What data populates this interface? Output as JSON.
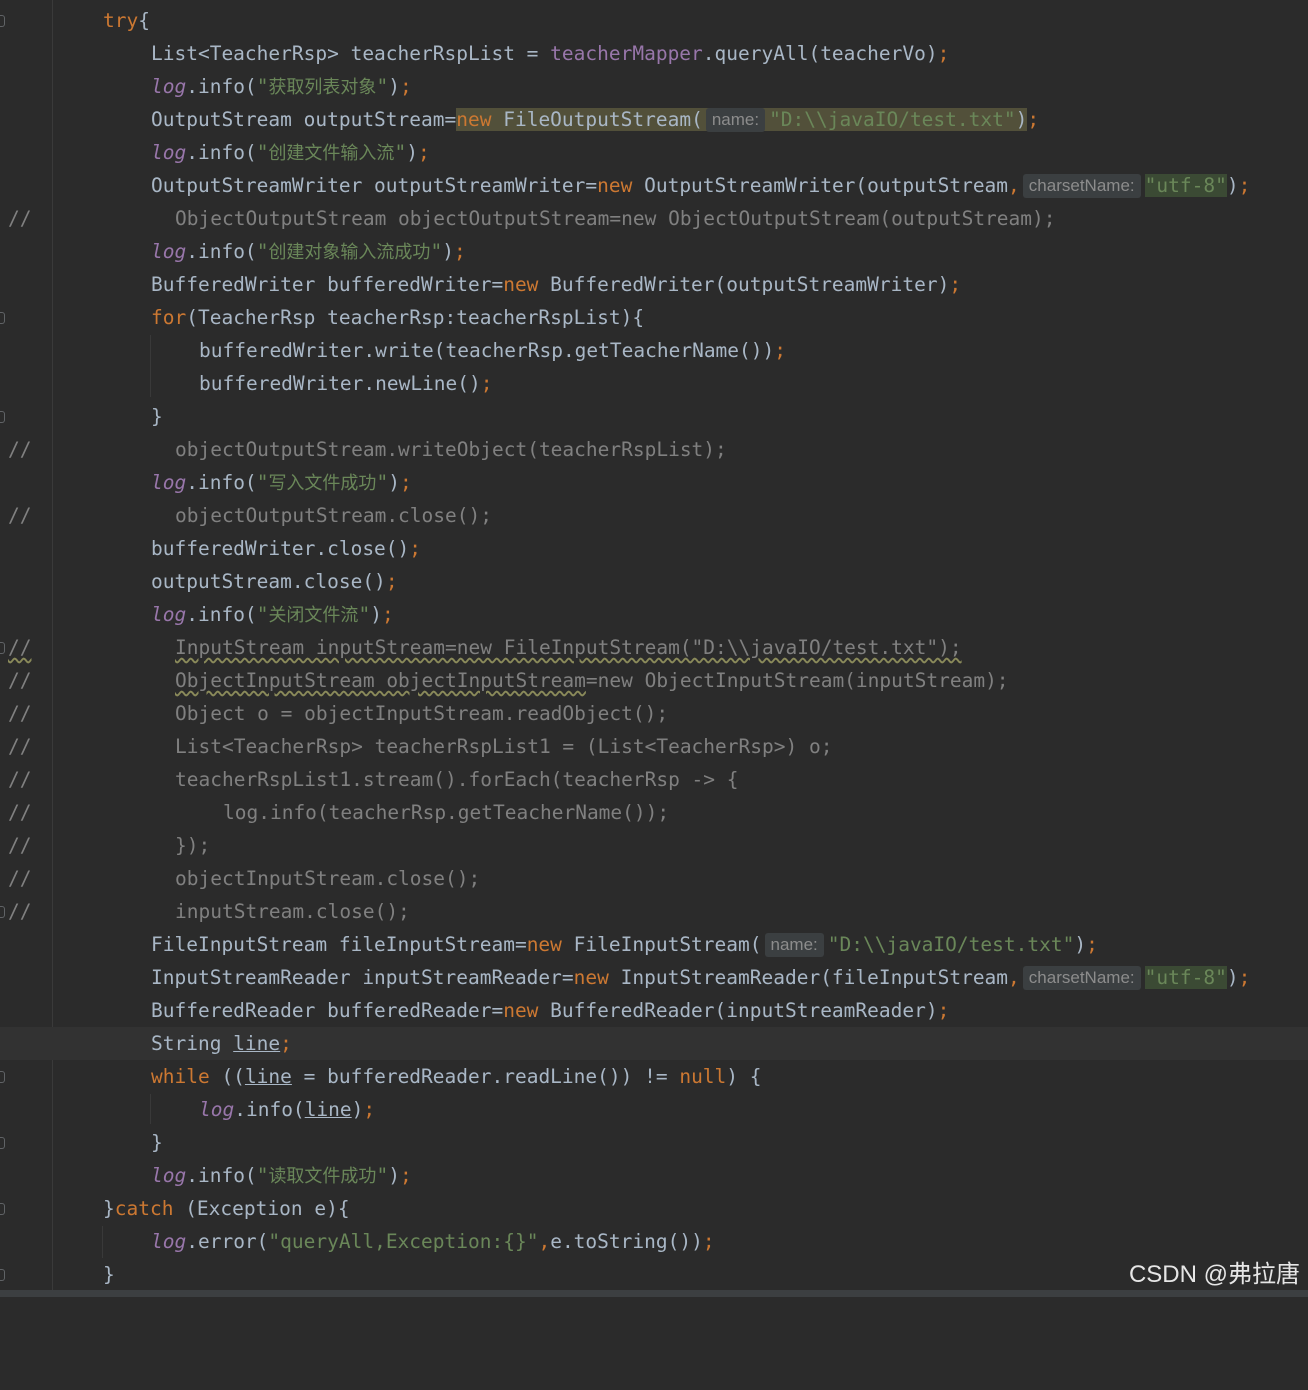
{
  "code": {
    "line_01": {
      "kw": "try",
      "rest": "{"
    },
    "line_02": {
      "a": "List<TeacherRsp> teacherRspList = ",
      "field": "teacherMapper",
      "b": ".queryAll(teacherVo)",
      "semi": ";"
    },
    "line_03": {
      "log": "log",
      "a": ".info(",
      "str_a": "\"",
      "cn": "获取列表对象",
      "str_b": "\"",
      "b": ")",
      "semi": ";"
    },
    "line_04": {
      "a": "OutputStream outputStream=",
      "kw": "new",
      "b": " FileOutputStream(",
      "hint": "name:",
      "str": "\"D:\\\\javaIO/test.txt\"",
      "c": ")",
      "semi": ";"
    },
    "line_05": {
      "log": "log",
      "a": ".info(",
      "str_a": "\"",
      "cn": "创建文件输入流",
      "str_b": "\"",
      "b": ")",
      "semi": ";"
    },
    "line_06": {
      "a": "OutputStreamWriter outputStreamWriter=",
      "kw": "new",
      "b": " OutputStreamWriter(outputStream",
      "comma": ",",
      "hint": "charsetName:",
      "str": "\"utf-8\"",
      "c": ")",
      "semi": ";"
    },
    "line_07": {
      "marker": "//",
      "text": "ObjectOutputStream objectOutputStream=new ObjectOutputStream(outputStream);"
    },
    "line_08": {
      "log": "log",
      "a": ".info(",
      "str_a": "\"",
      "cn": "创建对象输入流成功",
      "str_b": "\"",
      "b": ")",
      "semi": ";"
    },
    "line_09": {
      "a": "BufferedWriter bufferedWriter=",
      "kw": "new",
      "b": " BufferedWriter(outputStreamWriter)",
      "semi": ";"
    },
    "line_10": {
      "kw": "for",
      "a": "(TeacherRsp teacherRsp:teacherRspList){"
    },
    "line_11": {
      "a": "bufferedWriter.write(teacherRsp.getTeacherName())",
      "semi": ";"
    },
    "line_12": {
      "a": "bufferedWriter.newLine()",
      "semi": ";"
    },
    "line_13": {
      "a": "}"
    },
    "line_14": {
      "marker": "//",
      "text": "objectOutputStream.writeObject(teacherRspList);"
    },
    "line_15": {
      "log": "log",
      "a": ".info(",
      "str_a": "\"",
      "cn": "写入文件成功",
      "str_b": "\"",
      "b": ")",
      "semi": ";"
    },
    "line_16": {
      "marker": "//",
      "text": "objectOutputStream.close();"
    },
    "line_17": {
      "a": "bufferedWriter.close()",
      "semi": ";"
    },
    "line_18": {
      "a": "outputStream.close()",
      "semi": ";"
    },
    "line_19": {
      "log": "log",
      "a": ".info(",
      "str_a": "\"",
      "cn": "关闭文件流",
      "str_b": "\"",
      "b": ")",
      "semi": ";"
    },
    "line_20": {
      "marker": "//",
      "text": "InputStream inputStream=new FileInputStream(\"D:\\\\javaIO/test.txt\");"
    },
    "line_21": {
      "marker": "//",
      "a": "ObjectInputStream objectInputStream",
      "b": "=new ObjectInputStream(inputStream);"
    },
    "line_22": {
      "marker": "//",
      "text": "Object o = objectInputStream.readObject();"
    },
    "line_23": {
      "marker": "//",
      "text": "List<TeacherRsp> teacherRspList1 = (List<TeacherRsp>) o;"
    },
    "line_24": {
      "marker": "//",
      "text": "teacherRspList1.stream().forEach(teacherRsp -> {"
    },
    "line_25": {
      "marker": "//",
      "text": "log.info(teacherRsp.getTeacherName());"
    },
    "line_26": {
      "marker": "//",
      "text": "});"
    },
    "line_27": {
      "marker": "//",
      "text": "objectInputStream.close();"
    },
    "line_28": {
      "marker": "//",
      "text": "inputStream.close();"
    },
    "line_29": {
      "a": "FileInputStream fileInputStream=",
      "kw": "new",
      "b": " FileInputStream(",
      "hint": "name:",
      "str": "\"D:\\\\javaIO/test.txt\"",
      "c": ")",
      "semi": ";"
    },
    "line_30": {
      "a": "InputStreamReader inputStreamReader=",
      "kw": "new",
      "b": " InputStreamReader(fileInputStream",
      "comma": ",",
      "hint": "charsetName:",
      "str": "\"utf-8\"",
      "c": ")",
      "semi": ";"
    },
    "line_31": {
      "a": "BufferedReader bufferedReader=",
      "kw": "new",
      "b": " BufferedReader(inputStreamReader)",
      "semi": ";"
    },
    "line_32": {
      "a": "String ",
      "var": "line",
      "semi": ";"
    },
    "line_33": {
      "kw": "while",
      "a": " ((",
      "var": "line",
      "b": " = bufferedReader.readLine()) != ",
      "kw2": "null",
      "c": ") {"
    },
    "line_34": {
      "log": "log",
      "a": ".info(",
      "var": "line",
      "b": ")",
      "semi": ";"
    },
    "line_35": {
      "a": "}"
    },
    "line_36": {
      "log": "log",
      "a": ".info(",
      "str_a": "\"",
      "cn": "读取文件成功",
      "str_b": "\"",
      "b": ")",
      "semi": ";"
    },
    "line_37": {
      "a": "}",
      "kw": "catch",
      "b": " (Exception e){"
    },
    "line_38": {
      "log": "log",
      "a": ".error(",
      "str": "\"queryAll,Exception:{}\"",
      "comma": ",",
      "b": "e.toString())",
      "semi": ";"
    },
    "line_39": {
      "a": "}"
    }
  },
  "watermark": "CSDN @弗拉唐",
  "colors": {
    "background": "#2b2b2b",
    "text": "#a9b7c6",
    "keyword": "#cc7832",
    "string": "#6a8759",
    "field": "#9876aa",
    "comment": "#808080"
  }
}
